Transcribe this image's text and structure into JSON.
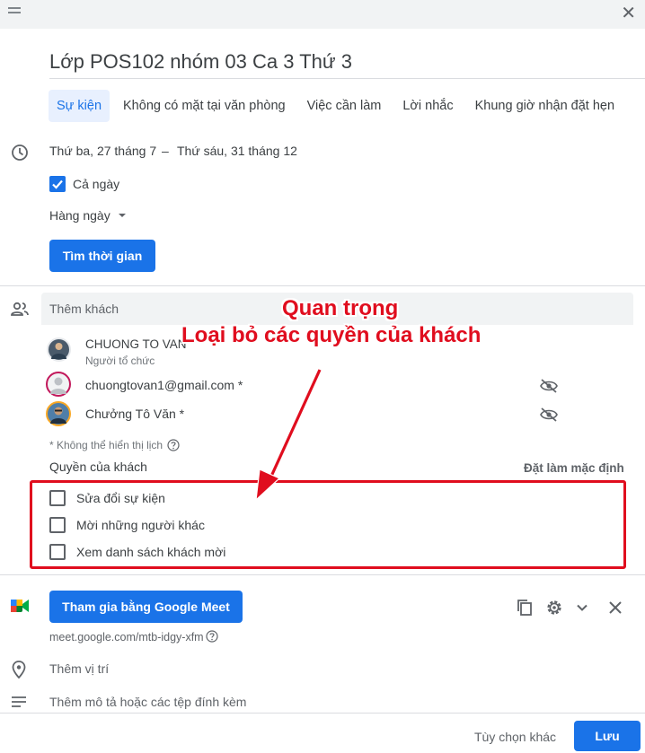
{
  "window": {
    "close_glyph": "✕"
  },
  "event": {
    "title": "Lớp POS102 nhóm 03 Ca 3 Thứ 3"
  },
  "tabs": [
    {
      "label": "Sự kiện",
      "active": true
    },
    {
      "label": "Không có mặt tại văn phòng"
    },
    {
      "label": "Việc cần làm"
    },
    {
      "label": "Lời nhắc"
    },
    {
      "label": "Khung giờ nhận đặt hẹn"
    }
  ],
  "datetime": {
    "start": "Thứ ba, 27 tháng 7",
    "separator": "–",
    "end": "Thứ sáu, 31 tháng 12",
    "all_day_label": "Cả ngày",
    "all_day_checked": true,
    "repeat": "Hàng ngày",
    "find_time_button": "Tìm thời gian"
  },
  "guests": {
    "add_placeholder": "Thêm khách",
    "list": [
      {
        "name": "CHUONG TO VAN",
        "role": "Người tổ chức"
      },
      {
        "name": "chuongtovan1@gmail.com *"
      },
      {
        "name": "Chưởng Tô Văn *"
      }
    ],
    "note": "* Không thể hiển thị lịch",
    "permissions_title": "Quyền của khách",
    "set_default": "Đặt làm mặc định",
    "permissions": [
      {
        "label": "Sửa đổi sự kiện",
        "checked": false
      },
      {
        "label": "Mời những người khác",
        "checked": false
      },
      {
        "label": "Xem danh sách khách mời",
        "checked": false
      }
    ]
  },
  "meet": {
    "join_button": "Tham gia bằng Google Meet",
    "link": "meet.google.com/mtb-idgy-xfm"
  },
  "location": {
    "placeholder": "Thêm vị trí"
  },
  "description": {
    "placeholder": "Thêm mô tả hoặc các tệp đính kèm"
  },
  "footer": {
    "more_options": "Tùy chọn khác",
    "save": "Lưu"
  },
  "annotation": {
    "line1": "Quan trọng",
    "line2": "Loại bỏ các quyền của khách"
  },
  "colors": {
    "accent": "#1a73e8",
    "annotation": "#e00d1e"
  }
}
